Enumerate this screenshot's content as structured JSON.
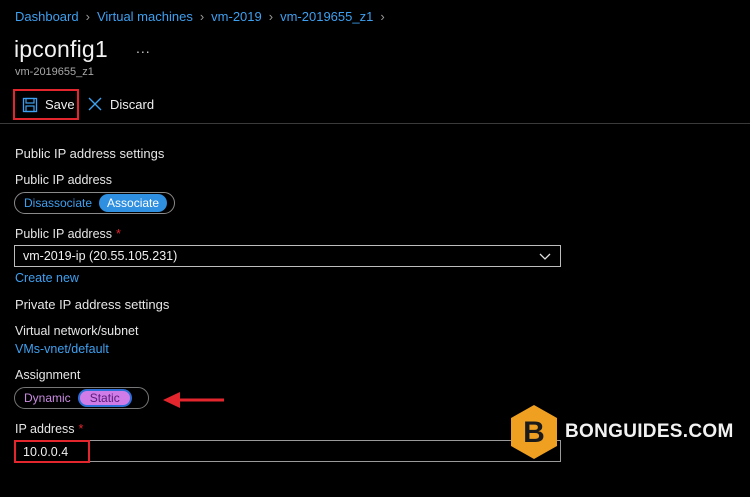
{
  "breadcrumb": [
    "Dashboard",
    "Virtual machines",
    "vm-2019",
    "vm-2019655_z1"
  ],
  "header": {
    "title": "ipconfig1",
    "more": "...",
    "subtitle": "vm-2019655_z1"
  },
  "toolbar": {
    "save_label": "Save",
    "discard_label": "Discard"
  },
  "public": {
    "section_title": "Public IP address settings",
    "toggle_label": "Public IP address",
    "options": [
      "Disassociate",
      "Associate"
    ],
    "selected": "Associate",
    "select_label": "Public IP address",
    "required_mark": "*",
    "select_value": "vm-2019-ip (20.55.105.231)",
    "create_new": "Create new"
  },
  "private": {
    "section_title": "Private IP address settings",
    "vnet_label": "Virtual network/subnet",
    "vnet_value": "VMs-vnet/default",
    "assignment_label": "Assignment",
    "options": [
      "Dynamic",
      "Static"
    ],
    "selected": "Static",
    "ip_label": "IP address",
    "required_mark": "*",
    "ip_value": "10.0.0.4"
  },
  "watermark": {
    "logo_letter": "B",
    "text": "BONGUIDES.COM"
  },
  "colors": {
    "accent": "#3ea0f0",
    "highlight": "#e3262e",
    "static_pill": "#d07ce8"
  }
}
